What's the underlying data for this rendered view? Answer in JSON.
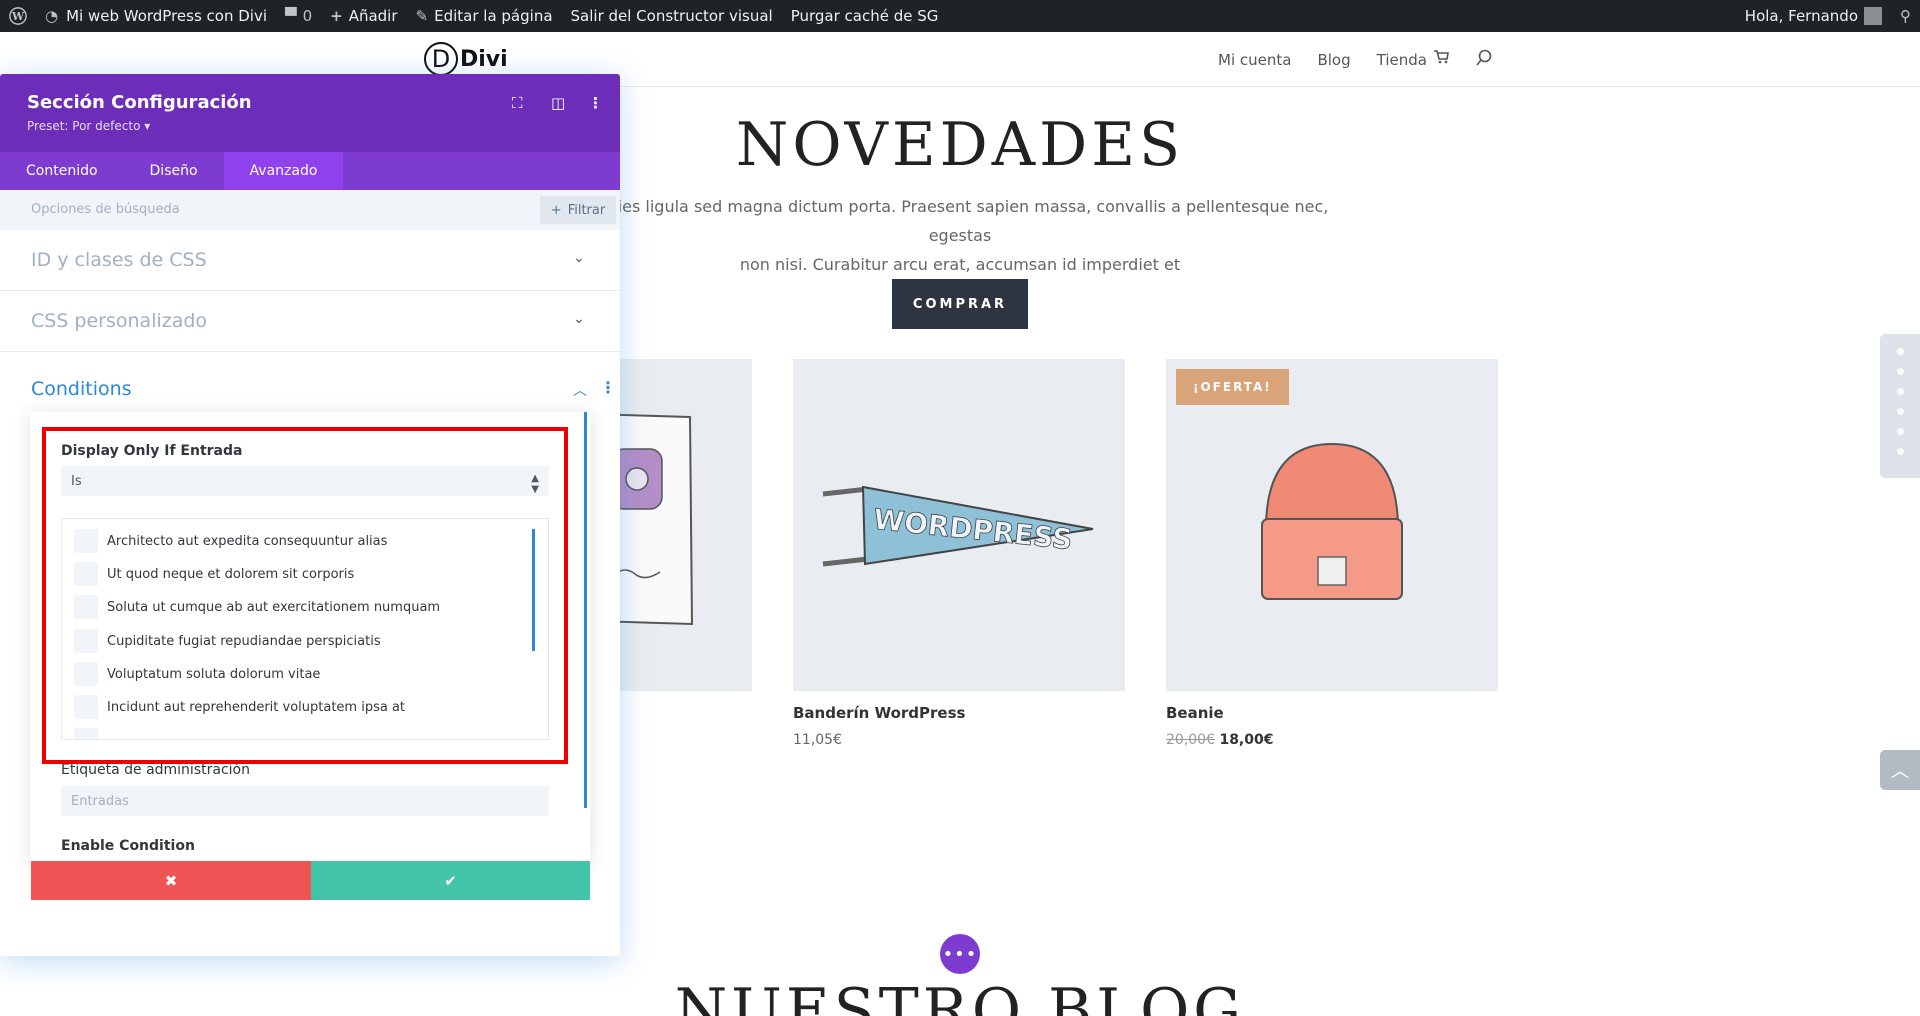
{
  "adminbar": {
    "site": "Mi web WordPress con Divi",
    "comments": "0",
    "add": "Añadir",
    "edit": "Editar la página",
    "exit": "Salir del Constructor visual",
    "purge": "Purgar caché de SG",
    "greeting": "Hola, Fernando"
  },
  "header": {
    "logo_letter": "D",
    "logo_text": "Divi",
    "nav": [
      "Mi cuenta",
      "Blog",
      "Tienda"
    ]
  },
  "hero": {
    "title": "NOVEDADES",
    "desc_line1": "tricies ligula sed magna dictum porta. Praesent sapien massa, convallis a pellentesque nec, egestas",
    "desc_line2": "non nisi. Curabitur arcu erat, accumsan id imperdiet et",
    "button": "COMPRAR"
  },
  "products": [
    {
      "name": "Banderín WordPress",
      "price": "11,05€"
    },
    {
      "name": "Beanie",
      "old_price": "20,00€",
      "price": "18,00€",
      "badge": "¡OFERTA!"
    }
  ],
  "pennant_text": "WORDPRESS",
  "blog_title": "NUESTRO BLOG",
  "panel": {
    "title": "Sección Configuración",
    "preset": "Preset: Por defecto ▾",
    "tabs": [
      "Contenido",
      "Diseño",
      "Avanzado"
    ],
    "active_tab": "Avanzado",
    "search_placeholder": "Opciones de búsqueda",
    "filter": "Filtrar",
    "sections": [
      "ID y clases de CSS",
      "CSS personalizado"
    ],
    "conditions": "Conditions"
  },
  "condition": {
    "label": "Display Only If Entrada",
    "select_value": "Is",
    "posts": [
      "Architecto aut expedita consequuntur alias",
      "Ut quod neque et dolorem sit corporis",
      "Soluta ut cumque ab aut exercitationem numquam",
      "Cupiditate fugiat repudiandae perspiciatis",
      "Voluptatum soluta dolorum vitae",
      "Incidunt aut reprehenderit voluptatem ipsa at"
    ],
    "admin_label": "Etiqueta de administración",
    "admin_placeholder": "Entradas",
    "enable_label": "Enable Condition"
  },
  "colors": {
    "purple": "#6c2eb9",
    "red": "#ef5555",
    "green": "#43c4a8",
    "blue": "#2b87da"
  }
}
